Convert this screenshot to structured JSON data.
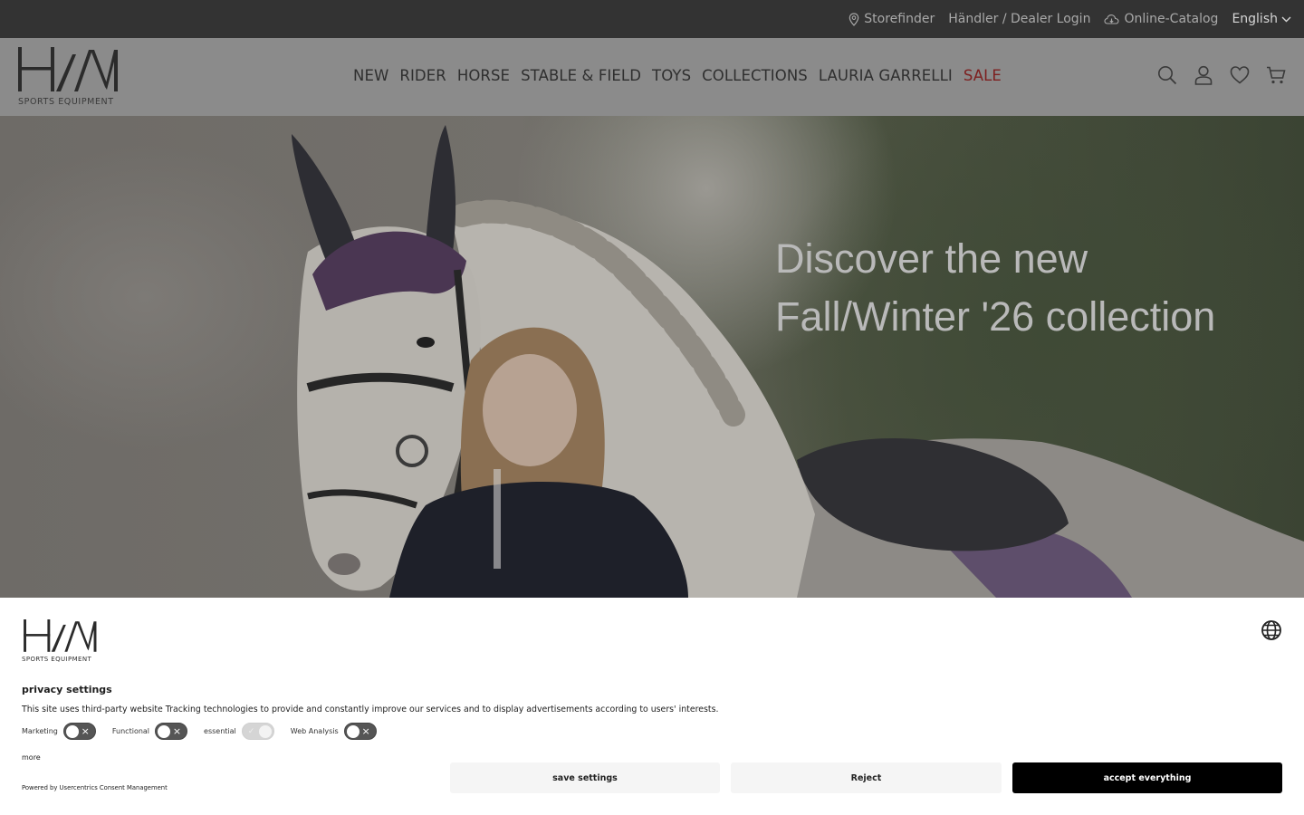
{
  "topbar": {
    "storefinder": "Storefinder",
    "dealer_login": "Händler / Dealer Login",
    "catalog": "Online-Catalog",
    "language": "English"
  },
  "brand": {
    "logo_text": "HM",
    "tagline": "SPORTS EQUIPMENT"
  },
  "nav": {
    "items": [
      "NEW",
      "RIDER",
      "HORSE",
      "STABLE & FIELD",
      "TOYS",
      "COLLECTIONS",
      "LAURIA GARRELLI",
      "SALE"
    ]
  },
  "header_icons": [
    "search-icon",
    "account-icon",
    "wishlist-icon",
    "cart-icon"
  ],
  "hero": {
    "headline_line1": "Discover the new",
    "headline_line2": "Fall/Winter '26 collection"
  },
  "consent": {
    "title": "privacy settings",
    "description": "This site uses third-party website Tracking technologies to provide and constantly improve our services and to display advertisements according to users' interests.",
    "toggles": [
      {
        "label": "Marketing",
        "enabled": false,
        "locked": false
      },
      {
        "label": "Functional",
        "enabled": false,
        "locked": false
      },
      {
        "label": "essential",
        "enabled": true,
        "locked": true
      },
      {
        "label": "Web Analysis",
        "enabled": false,
        "locked": false
      }
    ],
    "more_link": "more",
    "powered_by": "Powered by Usercentrics Consent Management",
    "buttons": {
      "save": "save settings",
      "reject": "Reject",
      "accept": "accept everything"
    }
  },
  "colors": {
    "topbar_bg": "#333333",
    "sale_accent": "#7d1f1f",
    "accept_button": "#000000"
  }
}
